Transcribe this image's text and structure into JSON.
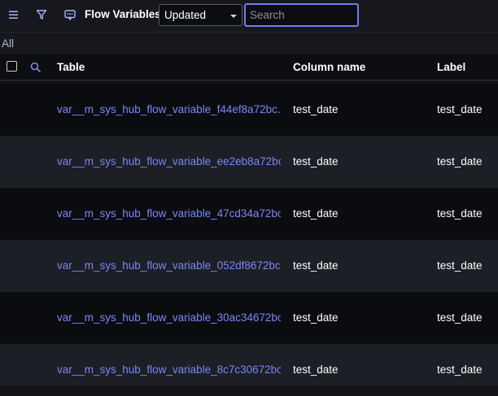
{
  "toolbar": {
    "menu_icon": "menu-icon",
    "filter_icon": "filter-icon",
    "context_icon": "context-menu-icon",
    "title": "Flow Variables",
    "select_value": "Updated",
    "search_placeholder": "Search"
  },
  "breadcrumb": {
    "label": "All"
  },
  "table": {
    "headers": {
      "table": "Table",
      "column_name": "Column name",
      "label": "Label"
    },
    "rows": [
      {
        "table": "var__m_sys_hub_flow_variable_f44ef8a72bc...",
        "column_name": "test_date",
        "label": "test_date"
      },
      {
        "table": "var__m_sys_hub_flow_variable_ee2eb8a72bc...",
        "column_name": "test_date",
        "label": "test_date"
      },
      {
        "table": "var__m_sys_hub_flow_variable_47cd34a72bc...",
        "column_name": "test_date",
        "label": "test_date"
      },
      {
        "table": "var__m_sys_hub_flow_variable_052df8672bc...",
        "column_name": "test_date",
        "label": "test_date"
      },
      {
        "table": "var__m_sys_hub_flow_variable_30ac34672bc...",
        "column_name": "test_date",
        "label": "test_date"
      },
      {
        "table": "var__m_sys_hub_flow_variable_8c7c30672bc...",
        "column_name": "test_date",
        "label": "test_date"
      }
    ]
  },
  "colors": {
    "accent": "#7b87f5",
    "background": "#121418"
  }
}
